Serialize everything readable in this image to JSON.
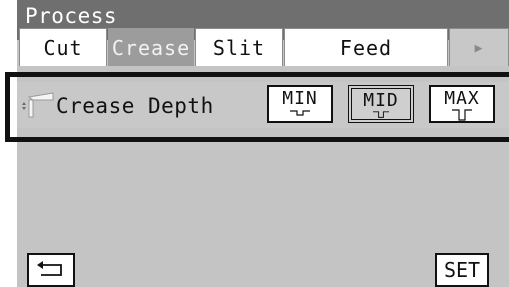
{
  "window": {
    "title": "Process"
  },
  "tabs": [
    {
      "label": "Cut",
      "active": false
    },
    {
      "label": "Crease",
      "active": true
    },
    {
      "label": "Slit",
      "active": false
    },
    {
      "label": "Feed",
      "active": false
    },
    {
      "label": "▶",
      "active": false
    }
  ],
  "setting": {
    "label": "Crease Depth",
    "icon": "crease-tool-icon",
    "options": [
      {
        "label": "MIN",
        "selected": false
      },
      {
        "label": "MID",
        "selected": true
      },
      {
        "label": "MAX",
        "selected": false
      }
    ]
  },
  "footer": {
    "back_icon": "return-arrow-icon",
    "set_label": "SET"
  },
  "colors": {
    "titlebar": "#6f6f6f",
    "panel": "#c4c4c4",
    "active_tab": "#9c9c9c",
    "highlight_border": "#111111"
  }
}
